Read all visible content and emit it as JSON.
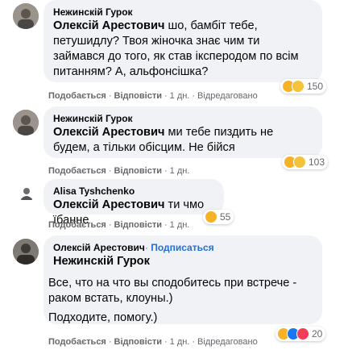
{
  "comments": [
    {
      "author": "Нежинскій Гурок",
      "mention": "Олексій Арестович",
      "text": " шо, бамбіт тебе, петушидлу? Твоя жіночка знає чим ти займався до того, як став іксперодом по всім питанням? А, альфонсішка?",
      "actions": {
        "like": "Подобається",
        "reply": "Відповісти",
        "time": "1 дн.",
        "edited": "Відредаговано"
      },
      "reactions": {
        "icons": [
          "haha-icon",
          "wow-icon"
        ],
        "count": "150"
      }
    },
    {
      "author": "Нежинскій Гурок",
      "mention": "Олексій Арестович",
      "text": " ми тебе пиздить не будем, а тільки обісцим. Не бійся",
      "actions": {
        "like": "Подобається",
        "reply": "Відповісти",
        "time": "1 дн."
      },
      "reactions": {
        "icons": [
          "haha-icon",
          "wow-icon"
        ],
        "count": "103"
      }
    },
    {
      "author": "Alisa Tyshchenko",
      "mention": "Олексій Арестович",
      "text": " ти чмо їбанне",
      "actions": {
        "like": "Подобається",
        "reply": "Відповісти",
        "time": "1 дн."
      },
      "reactions": {
        "icons": [
          "haha-icon"
        ],
        "count": "55"
      }
    },
    {
      "author": "Олексій Арестович",
      "follow": "Подписаться",
      "mention": "Нежинскій Гурок",
      "paragraph1": "Все, что на что вы сподобитесь при встрече - раком встать, клоуны.)",
      "paragraph2": "Подходите, помогу.)",
      "actions": {
        "like": "Подобається",
        "reply": "Відповісти",
        "time": "1 дн.",
        "edited": "Відредаговано"
      },
      "reactions": {
        "icons": [
          "haha-icon",
          "like-icon",
          "love-icon"
        ],
        "count": "20"
      }
    }
  ],
  "separator": "·",
  "colors": {
    "bubble": "#f0f2f5",
    "meta": "#65676b",
    "link": "#216fdb"
  }
}
